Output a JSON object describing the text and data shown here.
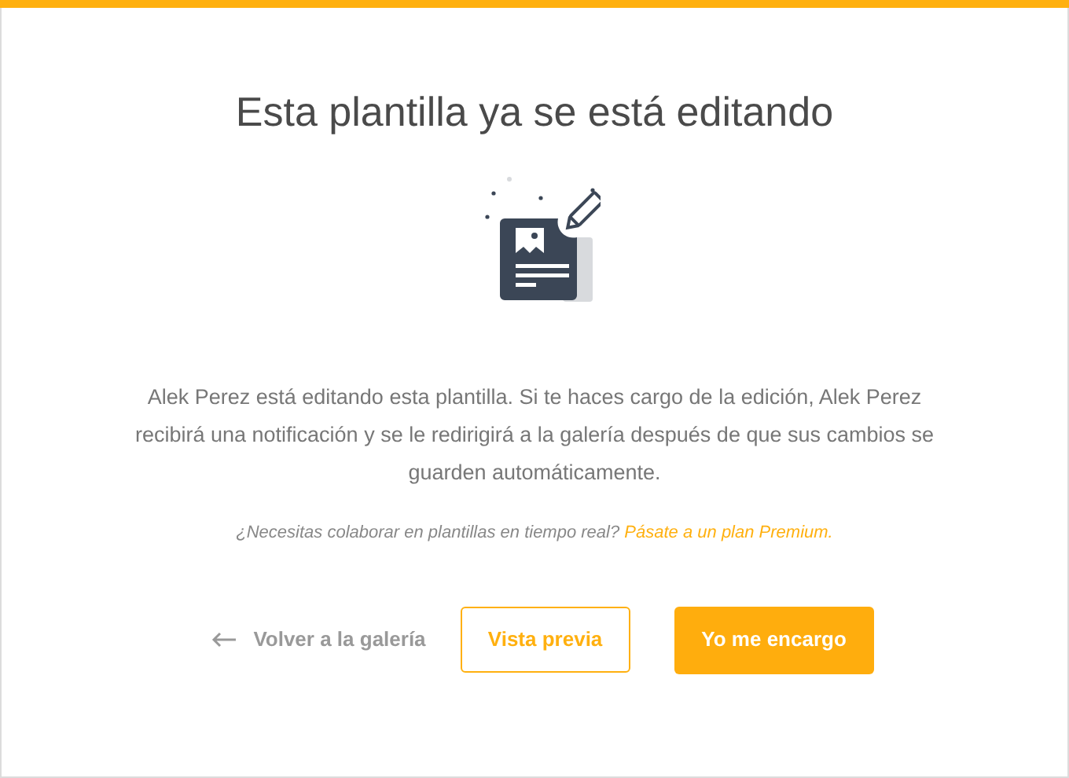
{
  "title": "Esta plantilla ya se está editando",
  "message": "Alek Perez está editando esta plantilla. Si te haces cargo de la edición, Alek Perez recibirá una notificación y se le redirigirá a la galería después de que sus cambios se guarden automáticamente.",
  "upsell": {
    "text": "¿Necesitas colaborar en plantillas en tiempo real?",
    "link": "Pásate a un plan Premium."
  },
  "actions": [
    {
      "kind": "back",
      "label": "Volver a la galería"
    },
    {
      "kind": "outline",
      "label": "Vista previa"
    },
    {
      "kind": "primary",
      "label": "Yo me encargo"
    }
  ]
}
